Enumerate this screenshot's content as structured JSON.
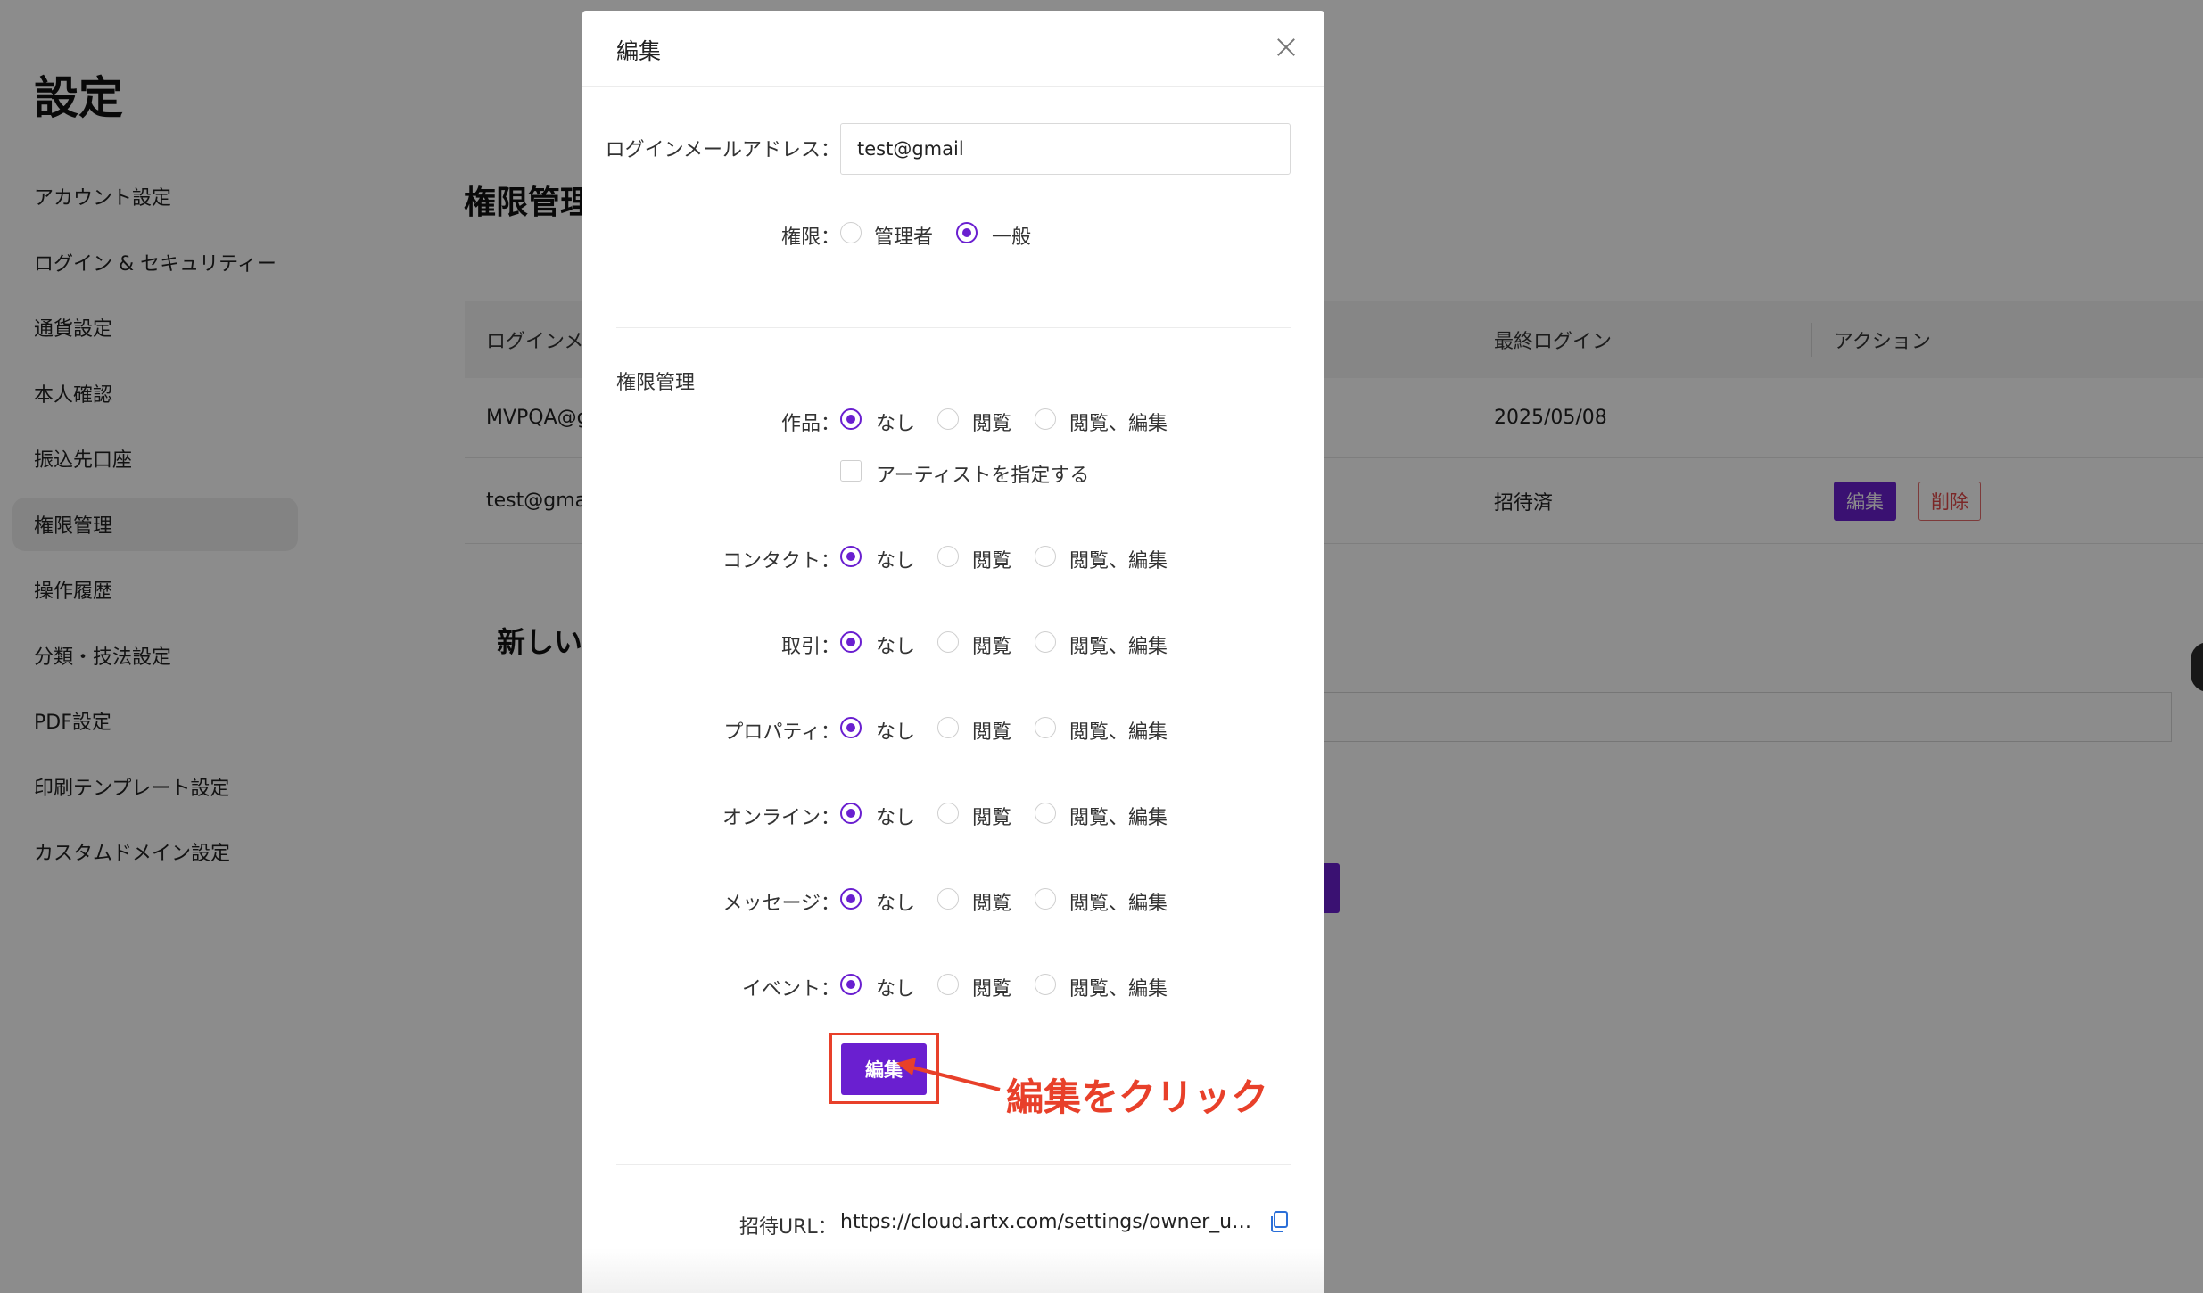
{
  "background": {
    "page_title": "設定",
    "sidebar": {
      "items": [
        {
          "label": "アカウント設定",
          "active": false
        },
        {
          "label": "ログイン & セキュリティー",
          "active": false
        },
        {
          "label": "通貨設定",
          "active": false
        },
        {
          "label": "本人確認",
          "active": false
        },
        {
          "label": "振込先口座",
          "active": false
        },
        {
          "label": "権限管理",
          "active": true
        },
        {
          "label": "操作履歴",
          "active": false
        },
        {
          "label": "分類・技法設定",
          "active": false
        },
        {
          "label": "PDF設定",
          "active": false
        },
        {
          "label": "印刷テンプレート設定",
          "active": false
        },
        {
          "label": "カスタムドメイン設定",
          "active": false
        }
      ]
    },
    "section_title": "権限管理",
    "table": {
      "headers": {
        "email": "ログインメールアドレス",
        "last_login": "最終ログイン",
        "action": "アクション"
      },
      "rows": [
        {
          "email": "MVPQA@gmail.com",
          "last_login": "2025/05/08"
        },
        {
          "email": "test@gmail",
          "last_login": "招待済",
          "edit": "編集",
          "delete": "削除"
        }
      ]
    },
    "new_section_title": "新しいユーザーを招待"
  },
  "modal": {
    "title": "編集",
    "email_label": "ログインメールアドレス：",
    "email_value": "test@gmail",
    "role": {
      "label": "権限：",
      "options": [
        {
          "label": "管理者",
          "selected": false
        },
        {
          "label": "一般",
          "selected": true
        }
      ]
    },
    "permissions_heading": "権限管理",
    "option_labels": {
      "none": "なし",
      "view": "閲覧",
      "view_edit": "閲覧、編集"
    },
    "artist_checkbox_label": "アーティストを指定する",
    "permissions": [
      {
        "label": "作品：",
        "selected": "none"
      },
      {
        "label": "コンタクト：",
        "selected": "none"
      },
      {
        "label": "取引：",
        "selected": "none"
      },
      {
        "label": "プロパティ：",
        "selected": "none"
      },
      {
        "label": "オンライン：",
        "selected": "none"
      },
      {
        "label": "メッセージ：",
        "selected": "none"
      },
      {
        "label": "イベント：",
        "selected": "none"
      }
    ],
    "submit_label": "編集",
    "invite_url_label": "招待URL：",
    "invite_url": "https://cloud.artx.com/settings/owner_users..."
  },
  "annotation": {
    "text": "編集をクリック",
    "color": "#e8402a"
  },
  "colors": {
    "accent": "#6a1fd0",
    "danger": "#e04848"
  }
}
